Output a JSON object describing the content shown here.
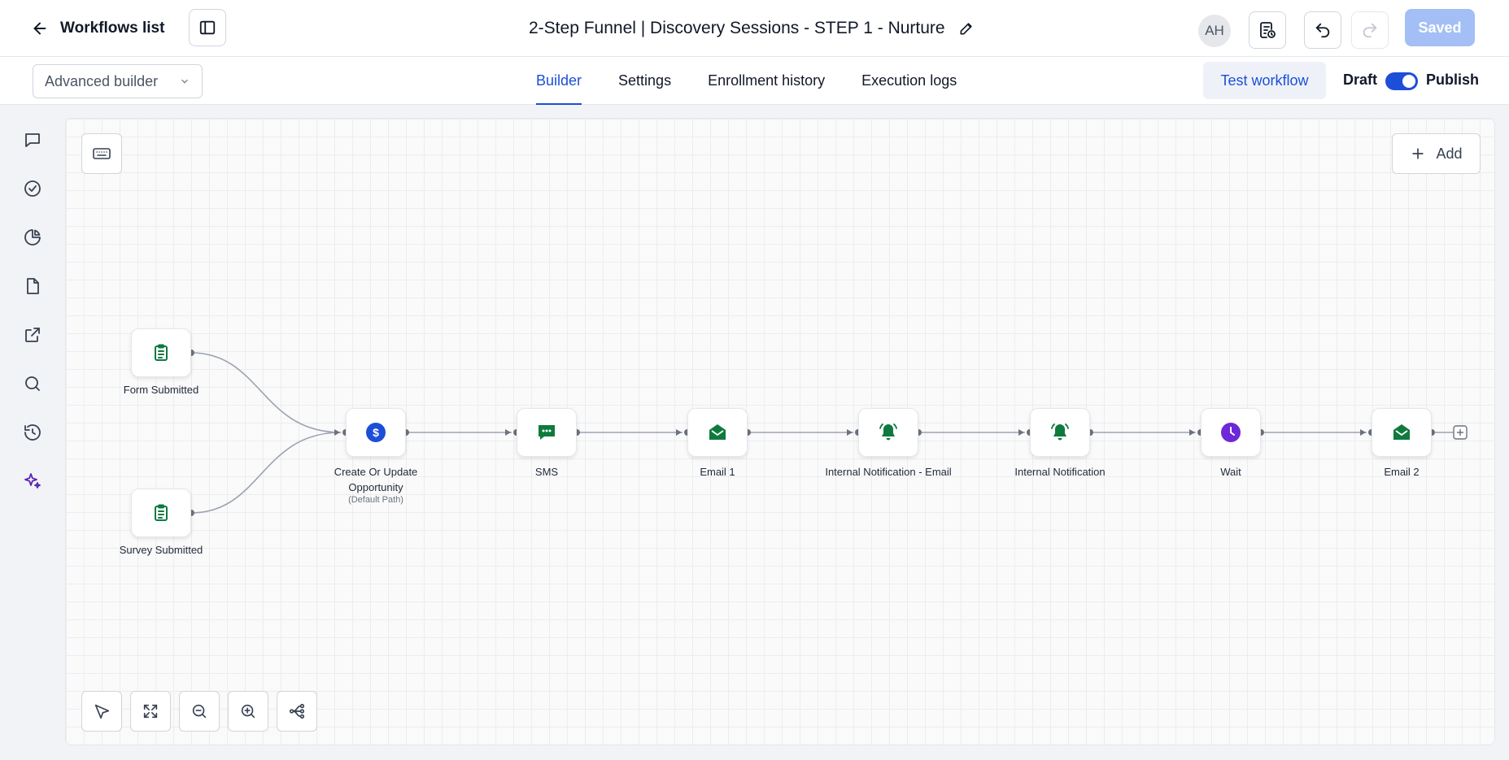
{
  "header": {
    "back_label": "Workflows list",
    "workflow_title": "2-Step Funnel | Discovery Sessions - STEP 1 - Nurture",
    "avatar_initials": "AH",
    "saved_label": "Saved"
  },
  "subbar": {
    "builder_mode": "Advanced builder",
    "tabs": [
      {
        "label": "Builder",
        "active": true
      },
      {
        "label": "Settings",
        "active": false
      },
      {
        "label": "Enrollment history",
        "active": false
      },
      {
        "label": "Execution logs",
        "active": false
      }
    ],
    "test_workflow_label": "Test workflow",
    "draft_label": "Draft",
    "publish_label": "Publish",
    "publish_enabled": true
  },
  "left_rail": [
    {
      "icon": "chat-icon"
    },
    {
      "icon": "check-circle-icon"
    },
    {
      "icon": "pie-chart-icon"
    },
    {
      "icon": "document-icon"
    },
    {
      "icon": "external-link-icon"
    },
    {
      "icon": "search-icon"
    },
    {
      "icon": "history-icon"
    },
    {
      "icon": "sparkles-icon"
    }
  ],
  "canvas": {
    "add_label": "Add",
    "triggers": [
      {
        "label": "Form Submitted",
        "icon": "clipboard-icon"
      },
      {
        "label": "Survey Submitted",
        "icon": "clipboard-icon"
      }
    ],
    "actions": [
      {
        "label": "Create Or Update Opportunity",
        "sublabel": "(Default Path)",
        "icon": "dollar-icon",
        "color": "#1d4ed8"
      },
      {
        "label": "SMS",
        "sublabel": "",
        "icon": "sms-icon",
        "color": "#0f7a3e"
      },
      {
        "label": "Email 1",
        "sublabel": "",
        "icon": "email-icon",
        "color": "#0f7a3e"
      },
      {
        "label": "Internal Notification - Email",
        "sublabel": "",
        "icon": "bell-icon",
        "color": "#0f7a3e"
      },
      {
        "label": "Internal Notification",
        "sublabel": "",
        "icon": "bell-icon",
        "color": "#0f7a3e"
      },
      {
        "label": "Wait",
        "sublabel": "",
        "icon": "clock-icon",
        "color": "#6d28d9"
      },
      {
        "label": "Email 2",
        "sublabel": "",
        "icon": "email-icon",
        "color": "#0f7a3e"
      }
    ],
    "toolbar": [
      {
        "icon": "pointer-icon"
      },
      {
        "icon": "fit-view-icon"
      },
      {
        "icon": "zoom-out-icon"
      },
      {
        "icon": "zoom-in-icon"
      },
      {
        "icon": "auto-layout-icon"
      }
    ]
  },
  "colors": {
    "accent": "#1d4ed8",
    "green": "#0f7a3e",
    "purple": "#6d28d9"
  }
}
